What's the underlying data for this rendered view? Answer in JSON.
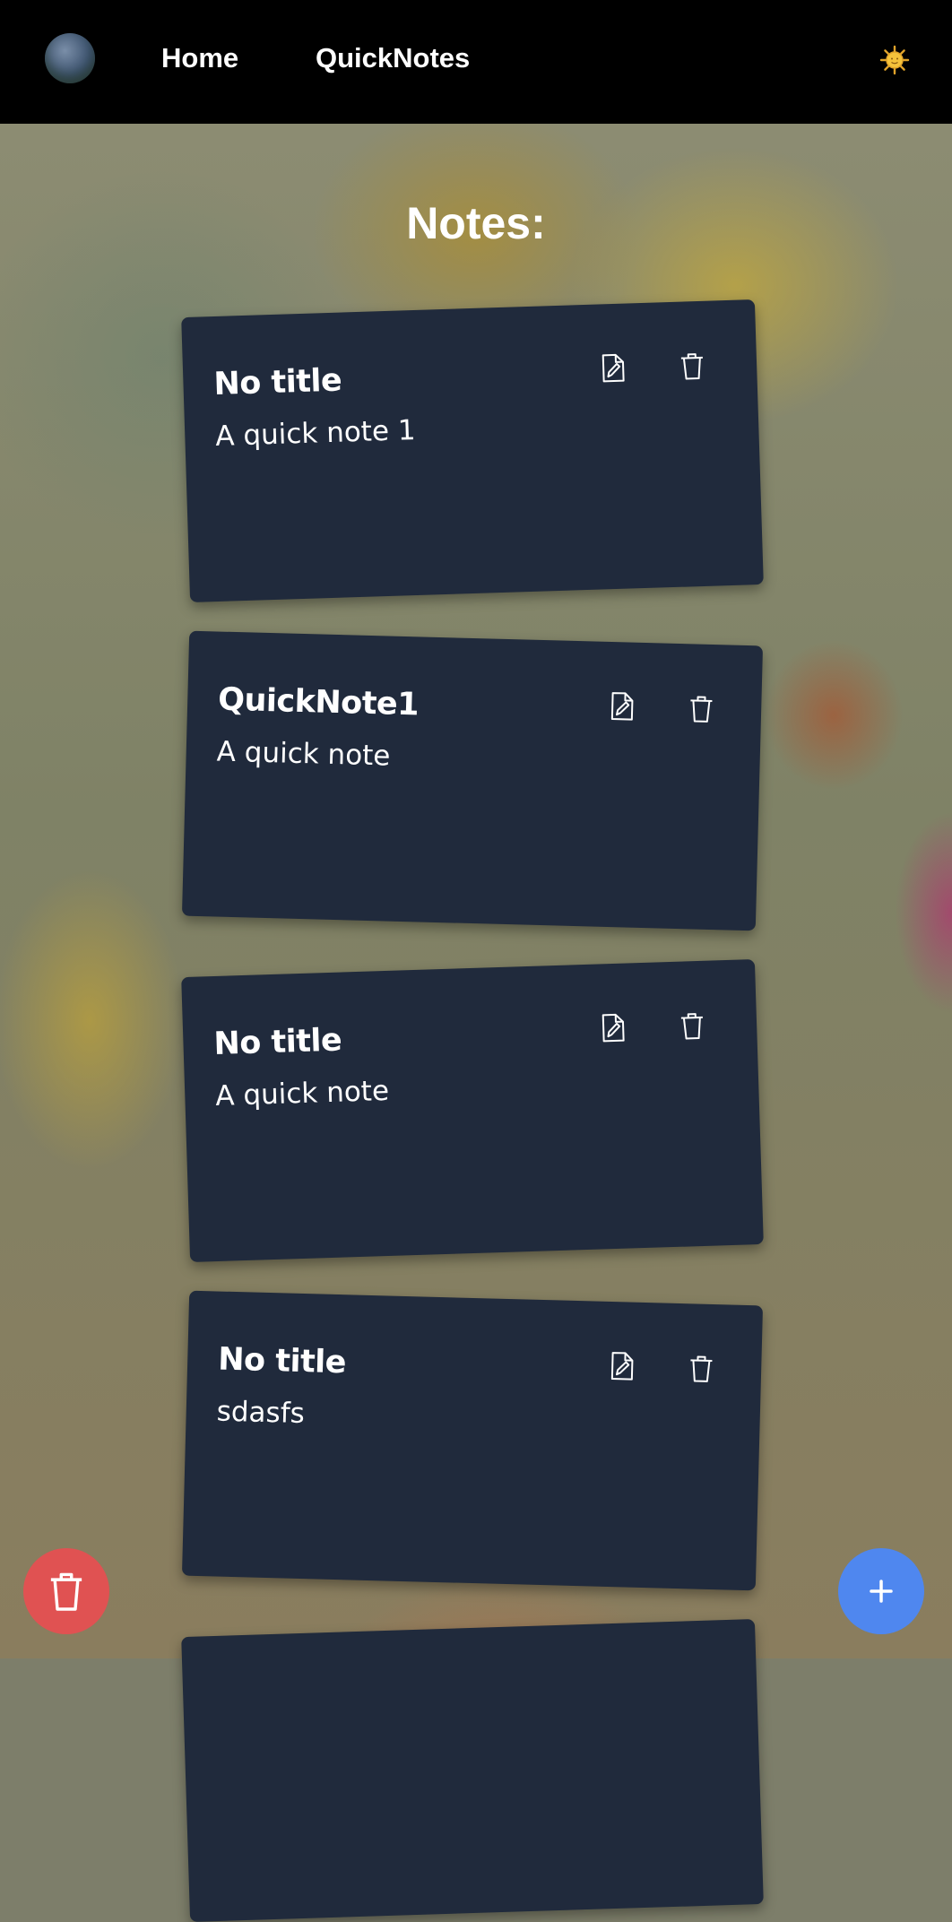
{
  "navbar": {
    "avatar_alt": "avatar",
    "links": [
      {
        "label": "Home"
      },
      {
        "label": "QuickNotes"
      }
    ],
    "theme_toggle_icon": "sun-icon"
  },
  "page": {
    "title": "Notes:"
  },
  "notes": [
    {
      "title": "No title",
      "body": "A quick note 1",
      "edit_icon": "edit-file-icon",
      "delete_icon": "trash-icon"
    },
    {
      "title": "QuickNote1",
      "body": "A quick note",
      "edit_icon": "edit-file-icon",
      "delete_icon": "trash-icon"
    },
    {
      "title": "No title",
      "body": "A quick note",
      "edit_icon": "edit-file-icon",
      "delete_icon": "trash-icon"
    },
    {
      "title": "No title",
      "body": "sdasfs",
      "edit_icon": "edit-file-icon",
      "delete_icon": "trash-icon"
    },
    {
      "title": "",
      "body": "",
      "edit_icon": "edit-file-icon",
      "delete_icon": "trash-icon"
    }
  ],
  "fabs": {
    "delete_all_icon": "trash-icon",
    "add_icon": "plus-icon"
  },
  "colors": {
    "navbar_bg": "#000000",
    "note_bg": "#202a3c",
    "delete_fab": "#e05252",
    "add_fab": "#4f87ef"
  }
}
